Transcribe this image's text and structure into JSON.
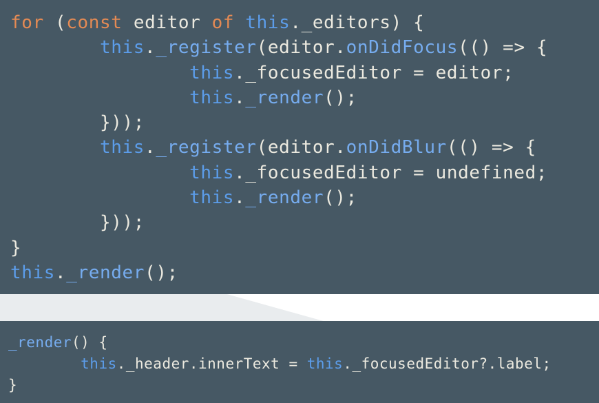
{
  "colors": {
    "panel_bg": "#465864",
    "text": "#ebe9df",
    "keyword": "#e48a54",
    "this": "#5c9dea",
    "function": "#76acef"
  },
  "top_code": {
    "lines": [
      {
        "indent": "",
        "tokens": [
          {
            "t": "for",
            "c": "kw"
          },
          {
            "t": " (",
            "c": "plain"
          },
          {
            "t": "const",
            "c": "kw"
          },
          {
            "t": " editor ",
            "c": "plain"
          },
          {
            "t": "of",
            "c": "kw"
          },
          {
            "t": " ",
            "c": "plain"
          },
          {
            "t": "this",
            "c": "this"
          },
          {
            "t": "._editors) {",
            "c": "plain"
          }
        ]
      },
      {
        "indent": "        ",
        "tokens": [
          {
            "t": "this",
            "c": "this"
          },
          {
            "t": ".",
            "c": "plain"
          },
          {
            "t": "_register",
            "c": "fn"
          },
          {
            "t": "(editor.",
            "c": "plain"
          },
          {
            "t": "onDidFocus",
            "c": "fn"
          },
          {
            "t": "(() => {",
            "c": "plain"
          }
        ]
      },
      {
        "indent": "                ",
        "tokens": [
          {
            "t": "this",
            "c": "this"
          },
          {
            "t": "._focusedEditor = editor;",
            "c": "plain"
          }
        ]
      },
      {
        "indent": "                ",
        "tokens": [
          {
            "t": "this",
            "c": "this"
          },
          {
            "t": ".",
            "c": "plain"
          },
          {
            "t": "_render",
            "c": "fn"
          },
          {
            "t": "();",
            "c": "plain"
          }
        ]
      },
      {
        "indent": "        ",
        "tokens": [
          {
            "t": "}));",
            "c": "plain"
          }
        ]
      },
      {
        "indent": "        ",
        "tokens": [
          {
            "t": "this",
            "c": "this"
          },
          {
            "t": ".",
            "c": "plain"
          },
          {
            "t": "_register",
            "c": "fn"
          },
          {
            "t": "(editor.",
            "c": "plain"
          },
          {
            "t": "onDidBlur",
            "c": "fn"
          },
          {
            "t": "(() => {",
            "c": "plain"
          }
        ]
      },
      {
        "indent": "                ",
        "tokens": [
          {
            "t": "this",
            "c": "this"
          },
          {
            "t": "._focusedEditor = undefined;",
            "c": "plain"
          }
        ]
      },
      {
        "indent": "                ",
        "tokens": [
          {
            "t": "this",
            "c": "this"
          },
          {
            "t": ".",
            "c": "plain"
          },
          {
            "t": "_render",
            "c": "fn"
          },
          {
            "t": "();",
            "c": "plain"
          }
        ]
      },
      {
        "indent": "        ",
        "tokens": [
          {
            "t": "}));",
            "c": "plain"
          }
        ]
      },
      {
        "indent": "",
        "tokens": [
          {
            "t": "}",
            "c": "plain"
          }
        ]
      },
      {
        "indent": "",
        "tokens": [
          {
            "t": "this",
            "c": "this"
          },
          {
            "t": ".",
            "c": "plain"
          },
          {
            "t": "_render",
            "c": "fn"
          },
          {
            "t": "();",
            "c": "plain"
          }
        ]
      }
    ]
  },
  "bottom_code": {
    "lines": [
      {
        "indent": "",
        "tokens": [
          {
            "t": "_render",
            "c": "fn"
          },
          {
            "t": "() {",
            "c": "plain"
          }
        ]
      },
      {
        "indent": "        ",
        "tokens": [
          {
            "t": "this",
            "c": "this"
          },
          {
            "t": "._header.innerText = ",
            "c": "plain"
          },
          {
            "t": "this",
            "c": "this"
          },
          {
            "t": "._focusedEditor?.label;",
            "c": "plain"
          }
        ]
      },
      {
        "indent": "",
        "tokens": [
          {
            "t": "}",
            "c": "plain"
          }
        ]
      }
    ]
  }
}
